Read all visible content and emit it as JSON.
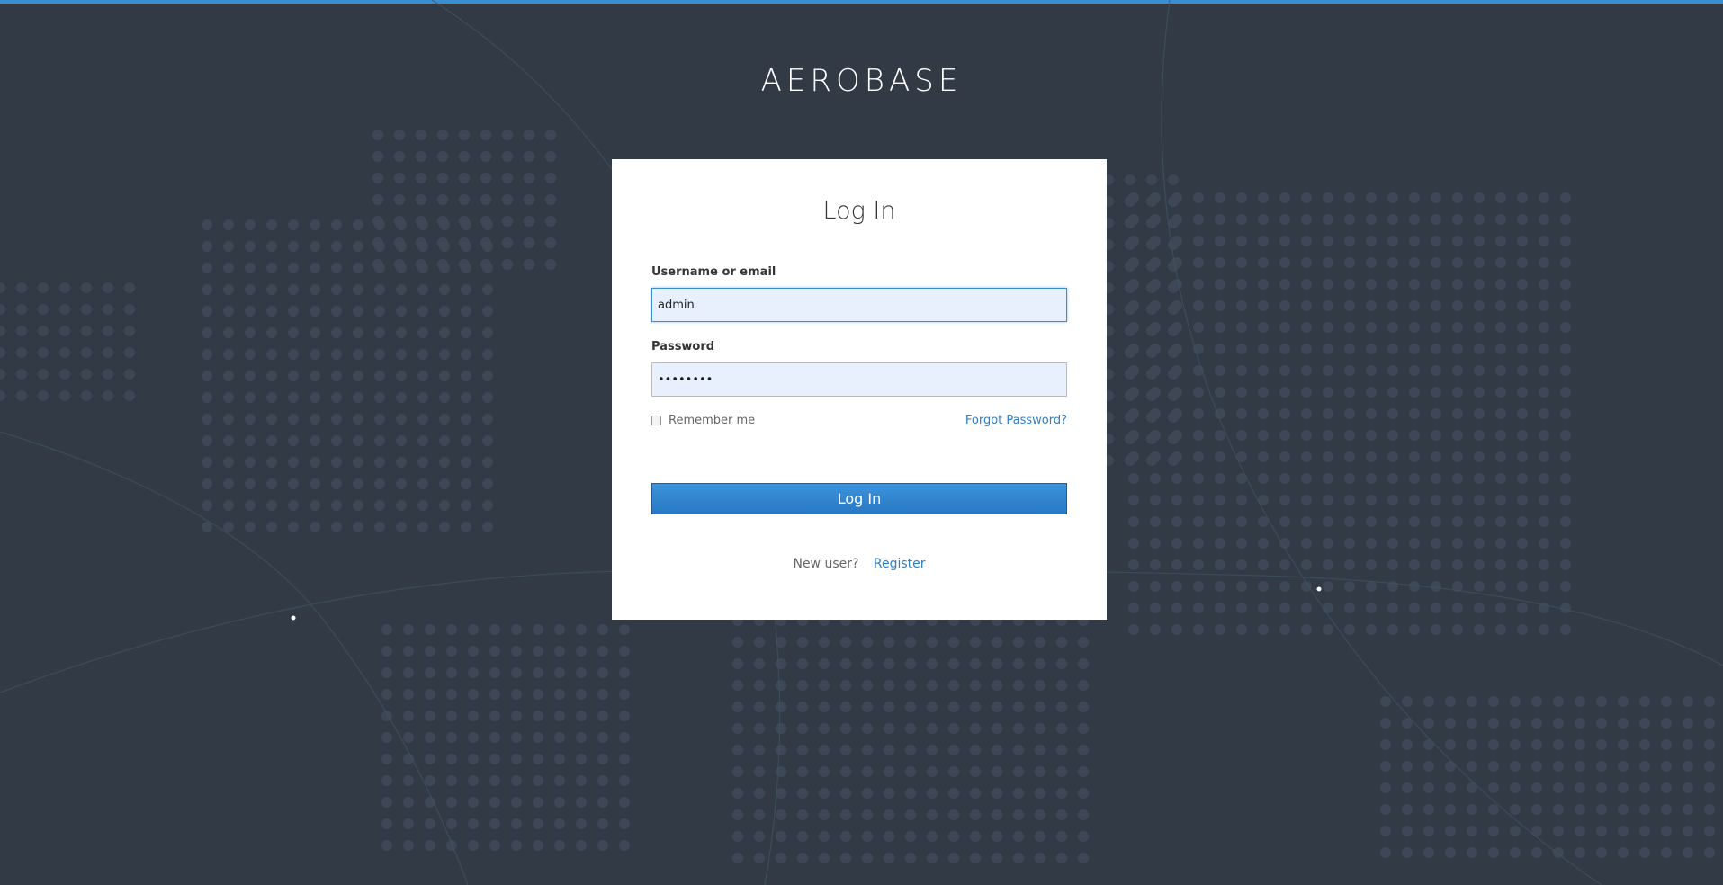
{
  "brand": {
    "title": "AEROBASE"
  },
  "login": {
    "title": "Log In",
    "username": {
      "label": "Username or email",
      "value": "admin"
    },
    "password": {
      "label": "Password",
      "value": "••••••••"
    },
    "remember_label": "Remember me",
    "remember_checked": false,
    "forgot_label": "Forgot Password?",
    "submit_label": "Log In",
    "new_user_label": "New user?",
    "register_label": "Register"
  },
  "colors": {
    "background": "#323a46",
    "accent": "#3a8fd4",
    "link": "#2f7fc6",
    "input_fill": "#e8f0fe"
  }
}
